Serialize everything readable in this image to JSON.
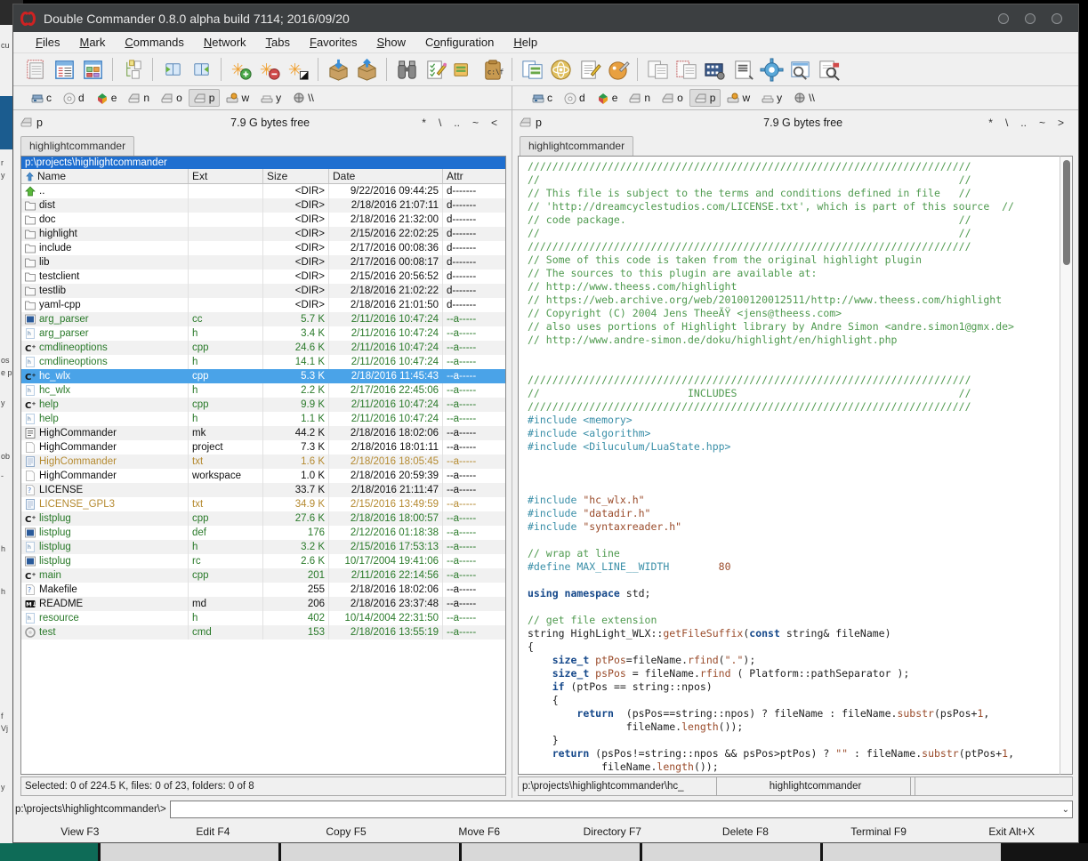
{
  "window": {
    "title": "Double Commander 0.8.0 alpha build 7114; 2016/09/20",
    "logo_name": "double-commander-logo",
    "buttons": [
      "minimize",
      "maximize",
      "close"
    ]
  },
  "menu": [
    {
      "label": "Files",
      "accel": "F"
    },
    {
      "label": "Mark",
      "accel": "M"
    },
    {
      "label": "Commands",
      "accel": "C"
    },
    {
      "label": "Network",
      "accel": "N"
    },
    {
      "label": "Tabs",
      "accel": "T"
    },
    {
      "label": "Favorites",
      "accel": "F"
    },
    {
      "label": "Show",
      "accel": "S"
    },
    {
      "label": "Configuration",
      "accel": "o"
    },
    {
      "label": "Help",
      "accel": "H"
    }
  ],
  "toolbar": [
    {
      "name": "briefview-icon"
    },
    {
      "name": "detailedview-icon"
    },
    {
      "name": "thumbnailview-icon"
    },
    {
      "sep": true
    },
    {
      "name": "treeview-icon"
    },
    {
      "sep": true
    },
    {
      "name": "open-left-icon"
    },
    {
      "name": "open-right-icon"
    },
    {
      "sep": true
    },
    {
      "name": "mark-plus-icon"
    },
    {
      "name": "mark-minus-icon"
    },
    {
      "name": "mark-invert-icon"
    },
    {
      "sep": true
    },
    {
      "name": "pack-icon"
    },
    {
      "name": "unpack-icon"
    },
    {
      "sep": true
    },
    {
      "name": "search-binoculars-icon"
    },
    {
      "name": "multirename-icon"
    },
    {
      "name": "copy-names-icon"
    },
    {
      "name": "cmdx-icon"
    },
    {
      "sep": true
    },
    {
      "name": "sync-dirs-icon"
    },
    {
      "name": "atom-icon"
    },
    {
      "name": "editor-icon"
    },
    {
      "name": "paint-icon"
    },
    {
      "sep": true
    },
    {
      "name": "compare-icon"
    },
    {
      "name": "select-all-icon"
    },
    {
      "name": "filmstrip-icon"
    },
    {
      "name": "view-file-icon"
    },
    {
      "name": "options-gear-icon"
    },
    {
      "name": "zoom-window-icon"
    },
    {
      "name": "search-files-icon"
    }
  ],
  "drives": [
    {
      "letter": "c",
      "icon": "hdd-icon",
      "selected": false
    },
    {
      "letter": "d",
      "icon": "cd-icon",
      "selected": false
    },
    {
      "letter": "e",
      "icon": "dropbox-icon",
      "selected": false
    },
    {
      "letter": "n",
      "icon": "net-drive-icon",
      "selected": false
    },
    {
      "letter": "o",
      "icon": "net-drive-icon",
      "selected": false
    },
    {
      "letter": "p",
      "icon": "net-drive-icon",
      "selected": true
    },
    {
      "letter": "w",
      "icon": "removable-icon",
      "selected": false
    },
    {
      "letter": "y",
      "icon": "floppy-icon",
      "selected": false
    },
    {
      "letter": "\\\\",
      "icon": "network-icon",
      "selected": false
    }
  ],
  "left_panel": {
    "drive_letter": "p",
    "free_space": "7.9 G bytes free",
    "nav_buttons": [
      "*",
      "\\",
      "..",
      "~",
      "<"
    ],
    "tab_label": "highlightcommander",
    "path": "p:\\projects\\highlightcommander",
    "columns": [
      {
        "label": "Name",
        "sort": "asc"
      },
      {
        "label": "Ext"
      },
      {
        "label": "Size"
      },
      {
        "label": "Date"
      },
      {
        "label": "Attr"
      }
    ],
    "status": "Selected: 0 of 224.5 K, files: 0 of 23, folders: 0 of 8",
    "files": [
      {
        "icon": "up-arrow-icon",
        "name": "..",
        "ext": "",
        "size": "<DIR>",
        "date": "9/22/2016 09:44:25",
        "attr": "d-------",
        "kind": "dir"
      },
      {
        "icon": "folder-icon",
        "name": "dist",
        "ext": "",
        "size": "<DIR>",
        "date": "2/18/2016 21:07:11",
        "attr": "d-------",
        "kind": "dir"
      },
      {
        "icon": "folder-icon",
        "name": "doc",
        "ext": "",
        "size": "<DIR>",
        "date": "2/18/2016 21:32:00",
        "attr": "d-------",
        "kind": "dir"
      },
      {
        "icon": "folder-icon",
        "name": "highlight",
        "ext": "",
        "size": "<DIR>",
        "date": "2/15/2016 22:02:25",
        "attr": "d-------",
        "kind": "dir"
      },
      {
        "icon": "folder-icon",
        "name": "include",
        "ext": "",
        "size": "<DIR>",
        "date": "2/17/2016 00:08:36",
        "attr": "d-------",
        "kind": "dir"
      },
      {
        "icon": "folder-icon",
        "name": "lib",
        "ext": "",
        "size": "<DIR>",
        "date": "2/17/2016 00:08:17",
        "attr": "d-------",
        "kind": "dir"
      },
      {
        "icon": "folder-icon",
        "name": "testclient",
        "ext": "",
        "size": "<DIR>",
        "date": "2/15/2016 20:56:52",
        "attr": "d-------",
        "kind": "dir"
      },
      {
        "icon": "folder-icon",
        "name": "testlib",
        "ext": "",
        "size": "<DIR>",
        "date": "2/18/2016 21:02:22",
        "attr": "d-------",
        "kind": "dir"
      },
      {
        "icon": "folder-icon",
        "name": "yaml-cpp",
        "ext": "",
        "size": "<DIR>",
        "date": "2/18/2016 21:01:50",
        "attr": "d-------",
        "kind": "dir"
      },
      {
        "icon": "code-blue-icon",
        "name": "arg_parser",
        "ext": "cc",
        "size": "5.7 K",
        "date": "2/11/2016 10:47:24",
        "attr": "--a-----",
        "kind": "file"
      },
      {
        "icon": "header-icon",
        "name": "arg_parser",
        "ext": "h",
        "size": "3.4 K",
        "date": "2/11/2016 10:47:24",
        "attr": "--a-----",
        "kind": "file"
      },
      {
        "icon": "cpp-icon",
        "name": "cmdlineoptions",
        "ext": "cpp",
        "size": "24.6 K",
        "date": "2/11/2016 10:47:24",
        "attr": "--a-----",
        "kind": "file"
      },
      {
        "icon": "header-icon",
        "name": "cmdlineoptions",
        "ext": "h",
        "size": "14.1 K",
        "date": "2/11/2016 10:47:24",
        "attr": "--a-----",
        "kind": "file"
      },
      {
        "icon": "cpp-icon",
        "name": "hc_wlx",
        "ext": "cpp",
        "size": "5.3 K",
        "date": "2/18/2016 11:45:43",
        "attr": "--a-----",
        "kind": "file",
        "selected": true
      },
      {
        "icon": "header-icon",
        "name": "hc_wlx",
        "ext": "h",
        "size": "2.2 K",
        "date": "2/17/2016 22:45:06",
        "attr": "--a-----",
        "kind": "file"
      },
      {
        "icon": "cpp-icon",
        "name": "help",
        "ext": "cpp",
        "size": "9.9 K",
        "date": "2/11/2016 10:47:24",
        "attr": "--a-----",
        "kind": "file"
      },
      {
        "icon": "header-icon",
        "name": "help",
        "ext": "h",
        "size": "1.1 K",
        "date": "2/11/2016 10:47:24",
        "attr": "--a-----",
        "kind": "file"
      },
      {
        "icon": "makefile-icon",
        "name": "HighCommander",
        "ext": "mk",
        "size": "44.2 K",
        "date": "2/18/2016 18:02:06",
        "attr": "--a-----",
        "kind": "dir"
      },
      {
        "icon": "blank-doc-icon",
        "name": "HighCommander",
        "ext": "project",
        "size": "7.3 K",
        "date": "2/18/2016 18:01:11",
        "attr": "--a-----",
        "kind": "dir"
      },
      {
        "icon": "text-doc-icon",
        "name": "HighCommander",
        "ext": "txt",
        "size": "1.6 K",
        "date": "2/18/2016 18:05:45",
        "attr": "--a-----",
        "kind": "dim"
      },
      {
        "icon": "blank-doc-icon",
        "name": "HighCommander",
        "ext": "workspace",
        "size": "1.0 K",
        "date": "2/18/2016 20:59:39",
        "attr": "--a-----",
        "kind": "dir"
      },
      {
        "icon": "unknown-icon",
        "name": "LICENSE",
        "ext": "",
        "size": "33.7 K",
        "date": "2/18/2016 21:11:47",
        "attr": "--a-----",
        "kind": "dir"
      },
      {
        "icon": "text-doc-icon",
        "name": "LICENSE_GPL3",
        "ext": "txt",
        "size": "34.9 K",
        "date": "2/15/2016 13:49:59",
        "attr": "--a-----",
        "kind": "dim"
      },
      {
        "icon": "cpp-icon",
        "name": "listplug",
        "ext": "cpp",
        "size": "27.6 K",
        "date": "2/18/2016 18:00:57",
        "attr": "--a-----",
        "kind": "file"
      },
      {
        "icon": "code-blue-icon",
        "name": "listplug",
        "ext": "def",
        "size": "176",
        "date": "2/12/2016 01:18:38",
        "attr": "--a-----",
        "kind": "file"
      },
      {
        "icon": "header-icon",
        "name": "listplug",
        "ext": "h",
        "size": "3.2 K",
        "date": "2/15/2016 17:53:13",
        "attr": "--a-----",
        "kind": "file"
      },
      {
        "icon": "code-blue-icon",
        "name": "listplug",
        "ext": "rc",
        "size": "2.6 K",
        "date": "10/17/2004 19:41:06",
        "attr": "--a-----",
        "kind": "file"
      },
      {
        "icon": "cpp-icon",
        "name": "main",
        "ext": "cpp",
        "size": "201",
        "date": "2/11/2016 22:14:56",
        "attr": "--a-----",
        "kind": "file"
      },
      {
        "icon": "unknown-icon",
        "name": "Makefile",
        "ext": "",
        "size": "255",
        "date": "2/18/2016 18:02:06",
        "attr": "--a-----",
        "kind": "dir"
      },
      {
        "icon": "markdown-icon",
        "name": "README",
        "ext": "md",
        "size": "206",
        "date": "2/18/2016 23:37:48",
        "attr": "--a-----",
        "kind": "dir"
      },
      {
        "icon": "header-icon",
        "name": "resource",
        "ext": "h",
        "size": "402",
        "date": "10/14/2004 22:31:50",
        "attr": "--a-----",
        "kind": "file"
      },
      {
        "icon": "gear-file-icon",
        "name": "test",
        "ext": "cmd",
        "size": "153",
        "date": "2/18/2016 13:55:19",
        "attr": "--a-----",
        "kind": "file"
      }
    ]
  },
  "right_panel": {
    "drive_letter": "p",
    "free_space": "7.9 G bytes free",
    "nav_buttons": [
      "*",
      "\\",
      "..",
      "~",
      ">"
    ],
    "tab_label": "highlightcommander",
    "status_file": "p:\\projects\\highlightcommander\\hc_",
    "status_tab": "highlightcommander",
    "status_extra1": "",
    "status_extra2": ""
  },
  "viewer": {
    "lines": [
      [
        [
          "cm",
          "////////////////////////////////////////////////////////////////////////"
        ]
      ],
      [
        [
          "cm",
          "//                                                                    //"
        ]
      ],
      [
        [
          "cm",
          "// This file is subject to the terms and conditions defined in file   //"
        ]
      ],
      [
        [
          "cm",
          "// 'http://dreamcyclestudios.com/LICENSE.txt', which is part of this source  //"
        ]
      ],
      [
        [
          "cm",
          "// code package.                                                      //"
        ]
      ],
      [
        [
          "cm",
          "//                                                                    //"
        ]
      ],
      [
        [
          "cm",
          "////////////////////////////////////////////////////////////////////////"
        ]
      ],
      [
        [
          "cm",
          "// Some of this code is taken from the original highlight plugin"
        ]
      ],
      [
        [
          "cm",
          "// The sources to this plugin are available at:"
        ]
      ],
      [
        [
          "cm",
          "// http://www.theess.com/highlight"
        ]
      ],
      [
        [
          "cm",
          "// https://web.archive.org/web/20100120012511/http://www.theess.com/highlight"
        ]
      ],
      [
        [
          "cm",
          "// Copyright (C) 2004 Jens TheeÃŸ <jens@theess.com>"
        ]
      ],
      [
        [
          "cm",
          "// also uses portions of Highlight library by Andre Simon <andre.simon1@gmx.de>"
        ]
      ],
      [
        [
          "cm",
          "// http://www.andre-simon.de/doku/highlight/en/highlight.php"
        ]
      ],
      [
        [
          "",
          ""
        ]
      ],
      [
        [
          "",
          ""
        ]
      ],
      [
        [
          "cm",
          "////////////////////////////////////////////////////////////////////////"
        ]
      ],
      [
        [
          "cm",
          "//                        INCLUDES                                    //"
        ]
      ],
      [
        [
          "cm",
          "////////////////////////////////////////////////////////////////////////"
        ]
      ],
      [
        [
          "pp",
          "#include <memory>"
        ]
      ],
      [
        [
          "pp",
          "#include <algorithm>"
        ]
      ],
      [
        [
          "pp",
          "#include <Diluculum/LuaState.hpp>"
        ]
      ],
      [
        [
          "",
          ""
        ]
      ],
      [
        [
          "",
          ""
        ]
      ],
      [
        [
          "",
          ""
        ]
      ],
      [
        [
          "pp",
          "#include "
        ],
        [
          "st",
          "\"hc_wlx.h\""
        ]
      ],
      [
        [
          "pp",
          "#include "
        ],
        [
          "st",
          "\"datadir.h\""
        ]
      ],
      [
        [
          "pp",
          "#include "
        ],
        [
          "st",
          "\"syntaxreader.h\""
        ]
      ],
      [
        [
          "",
          ""
        ]
      ],
      [
        [
          "cm",
          "// wrap at line"
        ]
      ],
      [
        [
          "pp",
          "#define MAX_LINE__WIDTH        "
        ],
        [
          "nu",
          "80"
        ]
      ],
      [
        [
          "",
          ""
        ]
      ],
      [
        [
          "kw",
          "using namespace "
        ],
        [
          "",
          "std;"
        ]
      ],
      [
        [
          "",
          ""
        ]
      ],
      [
        [
          "cm",
          "// get file extension"
        ]
      ],
      [
        [
          "",
          "string HighLight_WLX::"
        ],
        [
          "fn",
          "getFileSuffix"
        ],
        [
          "",
          "("
        ],
        [
          "kw",
          "const"
        ],
        [
          "",
          " string& fileName)"
        ]
      ],
      [
        [
          "",
          "{"
        ]
      ],
      [
        [
          "",
          "    "
        ],
        [
          "ty",
          "size_t"
        ],
        [
          "fn",
          " ptPos"
        ],
        [
          "",
          "=fileName."
        ],
        [
          "fn",
          "rfind"
        ],
        [
          "",
          "("
        ],
        [
          "st",
          "\".\""
        ],
        [
          "",
          ");"
        ]
      ],
      [
        [
          "",
          "    "
        ],
        [
          "ty",
          "size_t"
        ],
        [
          "fn",
          " psPos"
        ],
        [
          "",
          ""
        ],
        [
          "fn",
          " "
        ],
        [
          "",
          "= fileName."
        ],
        [
          "fn",
          "rfind"
        ],
        [
          "",
          " ( Platform::pathSeparator );"
        ]
      ],
      [
        [
          "",
          "    "
        ],
        [
          "kw",
          "if"
        ],
        [
          "bl",
          " (ptPos == string::npos)"
        ]
      ],
      [
        [
          "",
          "    {"
        ]
      ],
      [
        [
          "",
          "        "
        ],
        [
          "kw",
          "return"
        ],
        [
          "",
          "  (psPos==string::npos) ? fileName : fileName."
        ],
        [
          "fn",
          "substr"
        ],
        [
          "",
          "(psPos+"
        ],
        [
          "nu",
          "1"
        ],
        [
          "",
          ","
        ]
      ],
      [
        [
          "",
          "                fileName."
        ],
        [
          "fn",
          "length"
        ],
        [
          "",
          "());"
        ]
      ],
      [
        [
          "",
          "    }"
        ]
      ],
      [
        [
          "",
          "    "
        ],
        [
          "kw",
          "return"
        ],
        [
          "",
          " (psPos!=string::npos && psPos>ptPos) ? "
        ],
        [
          "st",
          "\"\""
        ],
        [
          "particle",
          " : fileName."
        ],
        [
          "fn",
          "substr"
        ],
        [
          "",
          "(ptPos+"
        ],
        [
          "nu",
          "1"
        ],
        [
          "",
          ","
        ]
      ],
      [
        [
          "",
          "            fileName."
        ],
        [
          "fn",
          "length"
        ],
        [
          "",
          "());"
        ]
      ],
      [
        [
          "",
          "}"
        ]
      ]
    ]
  },
  "command_line": {
    "prompt": "p:\\projects\\highlightcommander\\>",
    "value": "",
    "dropdown_icon": "chevron-down-icon"
  },
  "function_keys": [
    "View F3",
    "Edit F4",
    "Copy F5",
    "Move F6",
    "Directory F7",
    "Delete F8",
    "Terminal F9",
    "Exit Alt+X"
  ],
  "background": {
    "edge_texts": [
      "cu",
      "r",
      "y",
      "os",
      "e p",
      "y",
      "ob",
      "-",
      "h",
      "h",
      "f",
      "Vj",
      "y"
    ]
  },
  "colors": {
    "titlebar": "#3c3f41",
    "selection": "#4aa3e8",
    "path_bar": "#1f6fd0",
    "file_green": "#2a7a2a",
    "file_dim": "#b58a30",
    "comment_green": "#4f9a4f",
    "preproc_blue": "#3a8fa8",
    "keyword_blue": "#15488a",
    "taskbar_accent": "#0e6b57"
  }
}
